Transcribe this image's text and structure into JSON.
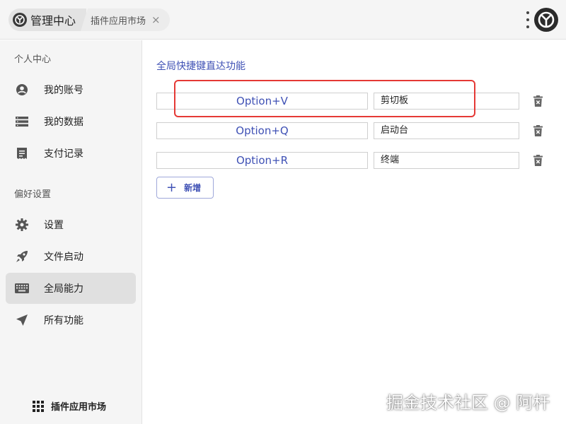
{
  "header": {
    "main_tab_label": "管理中心",
    "secondary_tab_label": "插件应用市场",
    "close_glyph": "×",
    "logo_icon": "y-logo-icon",
    "menu_icon": "kebab-menu-icon",
    "avatar_icon": "y-logo-avatar"
  },
  "sidebar": {
    "section_personal": "个人中心",
    "section_preferences": "偏好设置",
    "items": [
      {
        "label": "我的账号",
        "icon": "account-circle-icon"
      },
      {
        "label": "我的数据",
        "icon": "data-list-icon"
      },
      {
        "label": "支付记录",
        "icon": "receipt-icon"
      },
      {
        "label": "设置",
        "icon": "gear-icon"
      },
      {
        "label": "文件启动",
        "icon": "rocket-icon"
      },
      {
        "label": "全局能力",
        "icon": "keyboard-icon",
        "active": true
      },
      {
        "label": "所有功能",
        "icon": "send-icon"
      }
    ],
    "market_label": "插件应用市场",
    "market_icon": "grid-icon"
  },
  "main": {
    "title": "全局快捷键直达功能",
    "shortcuts": [
      {
        "key": "Option+V",
        "function": "剪切板"
      },
      {
        "key": "Option+Q",
        "function": "启动台"
      },
      {
        "key": "Option+R",
        "function": "终端"
      }
    ],
    "add_label": "新增",
    "add_glyph": "+"
  },
  "watermark": "掘金技术社区 @ 阿杆",
  "colors": {
    "accent": "#3f51b5",
    "highlight": "#e53935",
    "sidebar_bg": "#f5f5f5",
    "active_bg": "#e0e0e0"
  }
}
